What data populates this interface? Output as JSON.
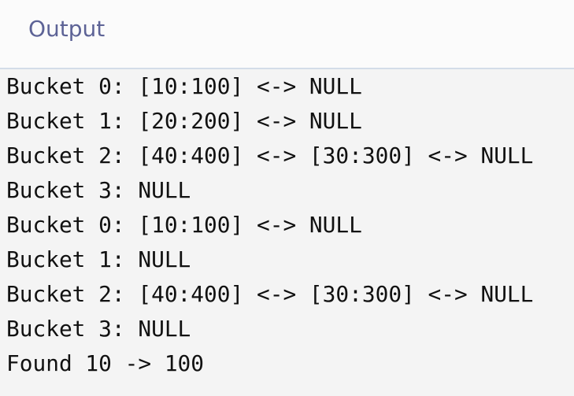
{
  "header": {
    "title": "Output"
  },
  "output": {
    "lines": [
      "Bucket 0: [10:100] <-> NULL",
      "Bucket 1: [20:200] <-> NULL",
      "Bucket 2: [40:400] <-> [30:300] <-> NULL",
      "Bucket 3: NULL",
      "Bucket 0: [10:100] <-> NULL",
      "Bucket 1: NULL",
      "Bucket 2: [40:400] <-> [30:300] <-> NULL",
      "Bucket 3: NULL",
      "Found 10 -> 100"
    ]
  }
}
